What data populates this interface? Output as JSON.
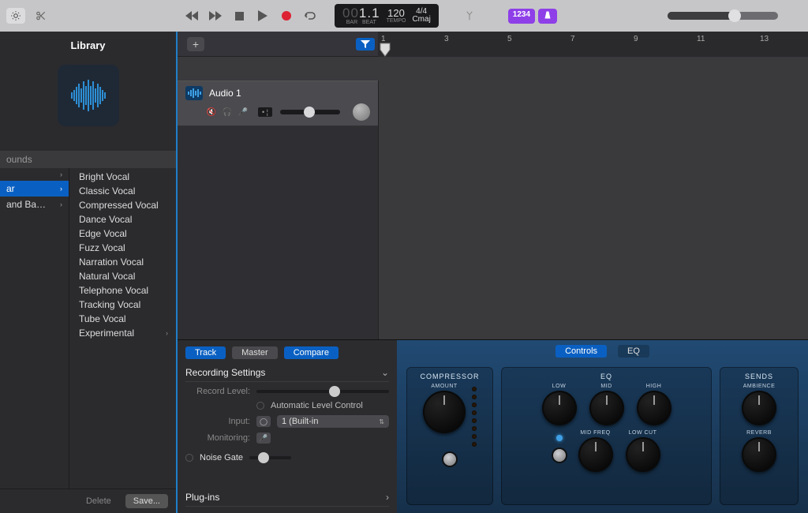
{
  "lcd": {
    "position": "1.1",
    "position_pre": "00",
    "position_lbl": "BAR",
    "beat_lbl": "BEAT",
    "tempo": "120",
    "tempo_lbl": "TEMPO",
    "sig": "4/4",
    "key": "Cmaj"
  },
  "badges": [
    "1234",
    "▲"
  ],
  "library": {
    "title": "Library",
    "category_header": "ounds",
    "left_cats": [
      {
        "label": "",
        "sel": false
      },
      {
        "label": "ar",
        "sel": true
      },
      {
        "label": "and Ba…",
        "sel": false
      }
    ],
    "vocals": [
      "Bright Vocal",
      "Classic Vocal",
      "Compressed Vocal",
      "Dance Vocal",
      "Edge Vocal",
      "Fuzz Vocal",
      "Narration Vocal",
      "Natural Vocal",
      "Telephone Vocal",
      "Tracking Vocal",
      "Tube Vocal",
      "Experimental"
    ],
    "delete": "Delete",
    "save": "Save..."
  },
  "track": {
    "name": "Audio 1",
    "vol_display": "0"
  },
  "ruler": [
    "1",
    "3",
    "5",
    "7",
    "9",
    "11",
    "13"
  ],
  "smart": {
    "tabs_left": [
      {
        "l": "Track",
        "a": true
      },
      {
        "l": "Master",
        "a": false
      },
      {
        "l": "Compare",
        "a": true
      }
    ],
    "tabs_right": [
      {
        "l": "Controls",
        "a": true
      },
      {
        "l": "EQ",
        "a": false
      }
    ],
    "rec_section": "Recording Settings",
    "record_level": "Record Level:",
    "alc": "Automatic Level Control",
    "input_lbl": "Input:",
    "input_val": "1 (Built-in",
    "monitoring": "Monitoring:",
    "noise_gate": "Noise Gate",
    "plugins": "Plug-ins",
    "panels": {
      "compressor": {
        "title": "COMPRESSOR",
        "k": [
          "AMOUNT"
        ]
      },
      "eq": {
        "title": "EQ",
        "k": [
          "LOW",
          "MID",
          "HIGH",
          "MID FREQ",
          "LOW CUT"
        ]
      },
      "sends": {
        "title": "SENDS",
        "k": [
          "AMBIENCE",
          "REVERB"
        ]
      }
    }
  }
}
